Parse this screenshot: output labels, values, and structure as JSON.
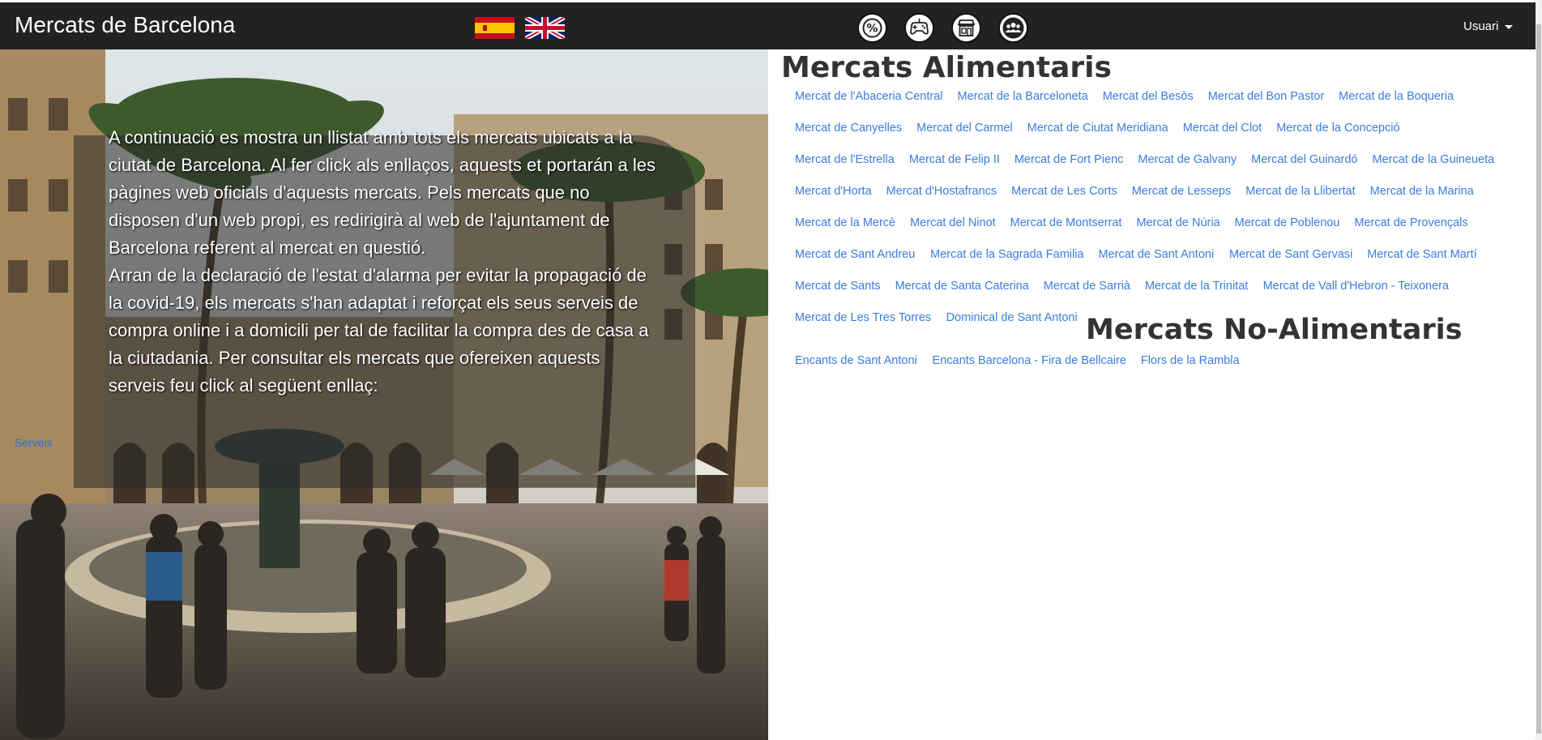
{
  "navbar": {
    "brand": "Mercats de Barcelona",
    "flags": [
      "spain-flag",
      "uk-flag"
    ],
    "icons": [
      "discount-percent-icon",
      "gamepad-icon",
      "market-store-icon",
      "users-group-icon"
    ],
    "user_label": "Usuari"
  },
  "intro": {
    "paragraph1": "A continuació es mostra un llistat amb tots els mercats ubicats a la ciutat de Barcelona. Al fer click als enllaços, aquests et portarán a les pàgines web oficials d'aquests mercats. Pels mercats que no disposen d'un web propi, es redirigirà al web de l'ajuntament de Barcelona referent al mercat en questió.",
    "paragraph2": "Arran de la declaració de l'estat d'alarma per evitar la propagació de la covid-19, els mercats s'han adaptat i reforçat els seus serveis de compra online i a domicili per tal de facilitar la compra des de casa a la ciutadania. Per consultar els mercats que ofereixen aquests serveis feu click al següent enllaç:",
    "link": "Serveis"
  },
  "food_markets": {
    "title": "Mercats Alimentaris",
    "items": [
      "Mercat de l'Abaceria Central",
      "Mercat de la Barceloneta",
      "Mercat del Besòs",
      "Mercat del Bon Pastor",
      "Mercat de la Boqueria",
      "Mercat de Canyelles",
      "Mercat del Carmel",
      "Mercat de Ciutat Meridiana",
      "Mercat del Clot",
      "Mercat de la Concepció",
      "Mercat de l'Estrella",
      "Mercat de Felip II",
      "Mercat de Fort Pienc",
      "Mercat de Galvany",
      "Mercat del Guinardó",
      "Mercat de la Guineueta",
      "Mercat d'Horta",
      "Mercat d'Hostafrancs",
      "Mercat de Les Corts",
      "Mercat de Lesseps",
      "Mercat de la Llibertat",
      "Mercat de la Marina",
      "Mercat de la Mercè",
      "Mercat del Ninot",
      "Mercat de Montserrat",
      "Mercat de Núria",
      "Mercat de Poblenou",
      "Mercat de Provençals",
      "Mercat de Sant Andreu",
      "Mercat de la Sagrada Familia",
      "Mercat de Sant Antoni",
      "Mercat de Sant Gervasi",
      "Mercat de Sant Martí",
      "Mercat de Sants",
      "Mercat de Santa Caterina",
      "Mercat de Sarrià",
      "Mercat de la Trinitat",
      "Mercat de Vall d'Hebron - Teixonera",
      "Mercat de Les Tres Torres",
      "Dominical de Sant Antoni"
    ]
  },
  "non_food_markets": {
    "title": "Mercats No-Alimentaris",
    "items": [
      "Encants de Sant Antoni",
      "Encants Barcelona - Fira de Bellcaire",
      "Flors de la Rambla"
    ]
  },
  "colors": {
    "navbar": "#222222",
    "link": "#3a7ce0",
    "heading": "#333333"
  }
}
